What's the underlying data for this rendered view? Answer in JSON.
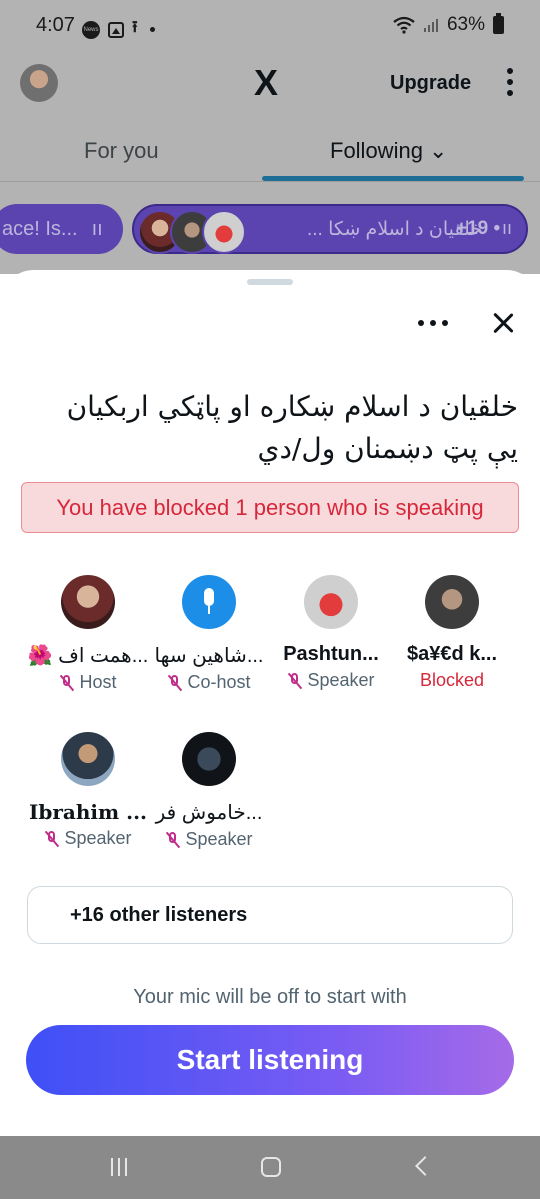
{
  "status_bar": {
    "time": "4:07",
    "news_badge": "News",
    "battery": "63%"
  },
  "header": {
    "logo": "X",
    "upgrade_label": "Upgrade"
  },
  "tabs": [
    {
      "label": "For you"
    },
    {
      "label": "Following ⌄"
    }
  ],
  "space_pills": [
    {
      "text": "ace! Is...",
      "eq": "ıı"
    },
    {
      "text": "خلقیان د اسلام ښکا ...",
      "count": "+19 •",
      "eq": "ıı"
    }
  ],
  "sheet": {
    "title": "خلقیان د اسلام ښکاره او پاټکي اربکیان يې پټ دښمنان ول/دي",
    "blocked_banner": "You have blocked 1 person who is speaking",
    "participants": [
      {
        "name": "$a¥€d k...",
        "role": "Blocked"
      },
      {
        "name": "Pashtun...",
        "role": "Speaker"
      },
      {
        "name": "شاهین سها...",
        "role": "Co-host"
      },
      {
        "name": "🌺 همت اف...",
        "role": "Host"
      },
      {
        "name": "خاموش فر...",
        "role": "Speaker"
      },
      {
        "name": "Ibrahim ...",
        "role": "Speaker"
      }
    ],
    "listeners_label": "+16 other listeners",
    "mic_note": "Your mic will be off to start with",
    "start_button": "Start listening"
  },
  "colors": {
    "accent": "#3e50f6",
    "blocked": "#d6283a",
    "pill": "#5b44b0"
  }
}
